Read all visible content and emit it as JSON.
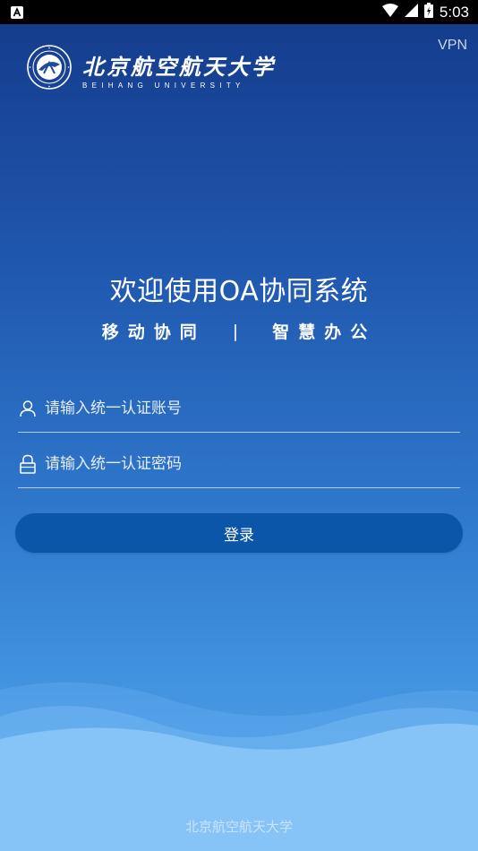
{
  "status_bar": {
    "time": "5:03"
  },
  "header": {
    "vpn_label": "VPN",
    "logo_cn": "北京航空航天大学",
    "logo_en": "BEIHANG UNIVERSITY"
  },
  "welcome": {
    "title": "欢迎使用OA协同系统",
    "slogan_left": "移动协同",
    "slogan_sep": "|",
    "slogan_right": "智慧办公"
  },
  "form": {
    "username_placeholder": "请输入统一认证账号",
    "password_placeholder": "请输入统一认证密码",
    "login_label": "登录"
  },
  "footer": {
    "text": "北京航空航天大学"
  },
  "colors": {
    "button_bg": "#0b56a8",
    "bg_top": "#143a8a",
    "bg_bottom": "#5aa8ee"
  }
}
